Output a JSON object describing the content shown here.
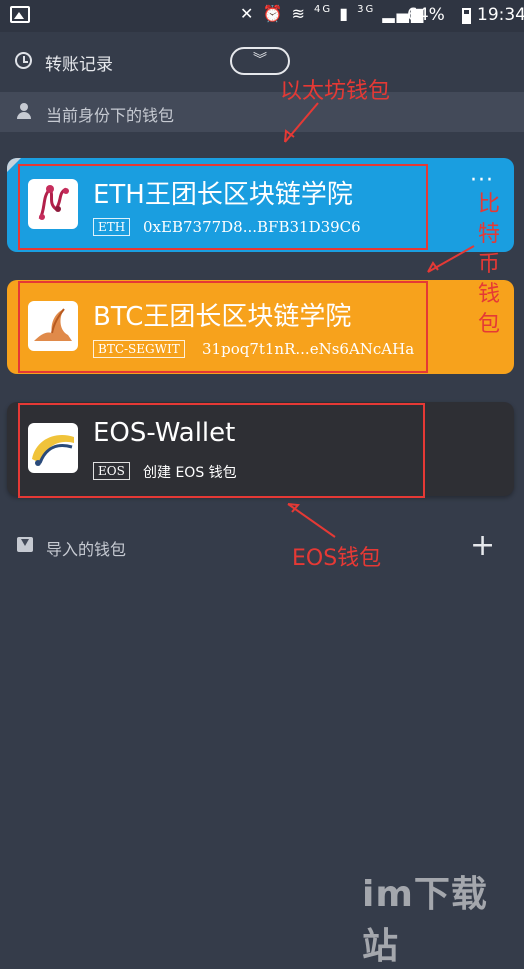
{
  "status_bar": {
    "icons": [
      "image-icon",
      "mute-icon",
      "alarm-icon",
      "wifi-icon",
      "sim-icon",
      "signal-icon",
      "battery-icon"
    ],
    "network_1": "4G",
    "network_2": "3G",
    "battery": "64%",
    "time": "19:34"
  },
  "header": {
    "history_label": "转账记录",
    "collapse_symbol": "︾"
  },
  "sections": {
    "current": "当前身份下的钱包",
    "imported": "导入的钱包",
    "add_symbol": "+"
  },
  "wallets": [
    {
      "title": "ETH王团长区块链学院",
      "badge": "ETH",
      "address": "0xEB7377D8...BFB31D39C6",
      "color": "#1a9ee0",
      "more": "···"
    },
    {
      "title": "BTC王团长区块链学院",
      "badge": "BTC-SEGWIT",
      "address": "31poq7t1nR...eNs6ANcAHa",
      "color": "#f7a21c"
    },
    {
      "title": "EOS-Wallet",
      "badge": "EOS",
      "address": "创建 EOS 钱包",
      "color": "#2e2f34"
    }
  ],
  "annotations": {
    "eth": "以太坊钱包",
    "btc": "比特币钱包",
    "eos": "EOS钱包",
    "color": "#e53935"
  },
  "watermark": "im下载站"
}
